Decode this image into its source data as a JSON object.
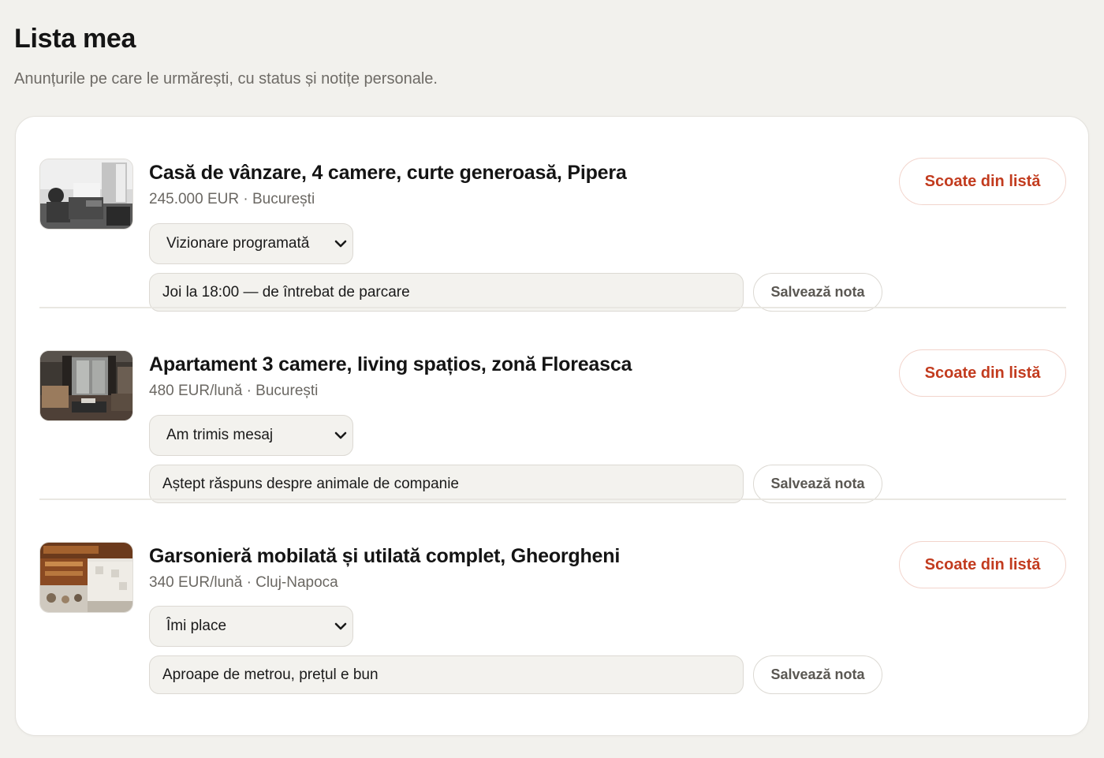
{
  "header": {
    "title": "Lista mea",
    "subtitle": "Anunțurile pe care le urmărești, cu status și notițe personale."
  },
  "listings": [
    {
      "title": "Casă de vânzare, 4 camere, curte generoasă, Pipera",
      "meta": "245.000 EUR · București",
      "status": "Vizionare programată",
      "note": "Joi la 18:00 — de întrebat de parcare",
      "save_label": "Salvează nota",
      "remove_label": "Scoate din listă"
    },
    {
      "title": "Apartament 3 camere, living spațios, zonă Floreasca",
      "meta": "480 EUR/lună · București",
      "status": "Am trimis mesaj",
      "note": "Aștept răspuns despre animale de companie",
      "save_label": "Salvează nota",
      "remove_label": "Scoate din listă"
    },
    {
      "title": "Garsonieră mobilată și utilată complet, Gheorgheni",
      "meta": "340 EUR/lună · Cluj-Napoca",
      "status": "Îmi place",
      "note": "Aproape de metrou, prețul e bun",
      "save_label": "Salvează nota",
      "remove_label": "Scoate din listă"
    }
  ],
  "icons": {
    "select_arrow": "chevron-down-icon"
  },
  "colors": {
    "background": "#f2f1ed",
    "card": "#ffffff",
    "accent_red": "#c23b1e",
    "input_bg": "#f3f2ee"
  }
}
